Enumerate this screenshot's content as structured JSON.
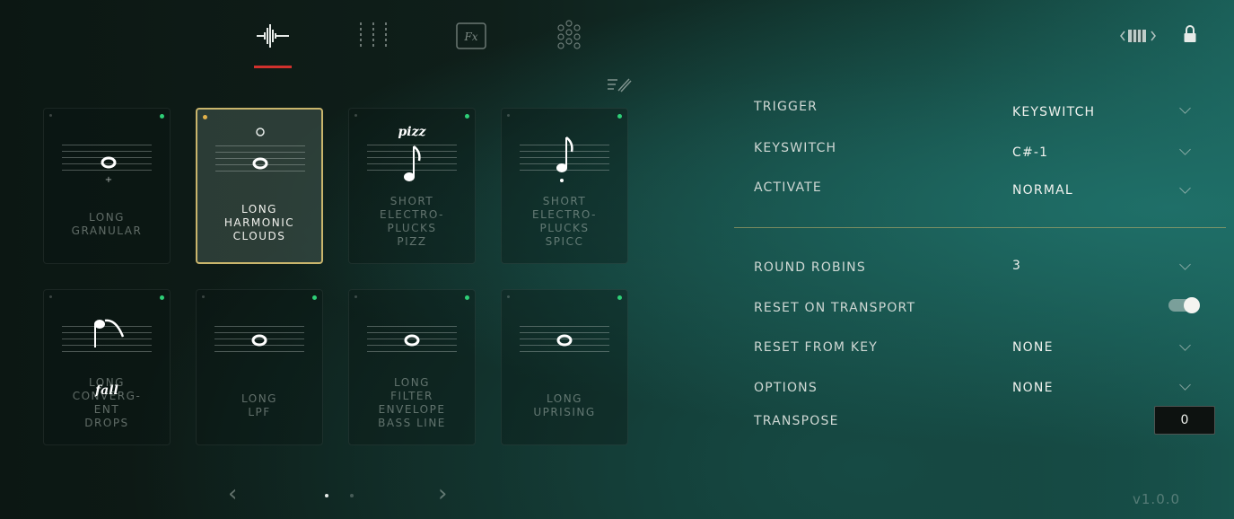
{
  "header": {
    "tabs": [
      {
        "icon": "waveform-icon"
      },
      {
        "icon": "mixer-sliders-icon"
      },
      {
        "icon": "fx-icon",
        "label": "Fx"
      },
      {
        "icon": "dots-grid-icon"
      }
    ],
    "active_tab": 0,
    "keyboard_icon": "keyboard-range-icon",
    "lock_icon": "lock-icon",
    "edit_icon": "edit-pencil-icon"
  },
  "articulations": [
    {
      "label": "LONG\nGRANULAR",
      "active_dot": true,
      "selected": false
    },
    {
      "label": "LONG\nHARMONIC\nCLOUDS",
      "active_dot": false,
      "selected": true
    },
    {
      "label": "SHORT\nELECTRO-\nPLUCKS\nPIZZ",
      "active_dot": true,
      "selected": false,
      "marking": "pizz"
    },
    {
      "label": "SHORT\nELECTRO-\nPLUCKS\nSPICC",
      "active_dot": true,
      "selected": false
    },
    {
      "label": "LONG\nCONVERG-\nENT\nDROPS",
      "active_dot": true,
      "selected": false,
      "marking": "fall"
    },
    {
      "label": "LONG\nLPF",
      "active_dot": true,
      "selected": false
    },
    {
      "label": "LONG\nFILTER\nENVELOPE\nBASS LINE",
      "active_dot": true,
      "selected": false
    },
    {
      "label": "LONG\nUPRISING",
      "active_dot": true,
      "selected": false
    }
  ],
  "pager": {
    "prev": "‹",
    "next": "›",
    "pages": 2,
    "current": 1
  },
  "settings": {
    "trigger": {
      "label": "TRIGGER",
      "value": "KEYSWITCH"
    },
    "keyswitch": {
      "label": "KEYSWITCH",
      "value": "C#-1"
    },
    "activate": {
      "label": "ACTIVATE",
      "value": "NORMAL"
    },
    "round_robins": {
      "label": "ROUND ROBINS",
      "value": "3"
    },
    "reset_on_transport": {
      "label": "RESET ON TRANSPORT",
      "enabled": true
    },
    "reset_from_key": {
      "label": "RESET FROM KEY",
      "value": "NONE"
    },
    "options": {
      "label": "OPTIONS",
      "value": "NONE"
    },
    "transpose": {
      "label": "TRANSPOSE",
      "value": "0"
    }
  },
  "version": "v1.0.0",
  "colors": {
    "accent_red": "#d0312d",
    "selected_border": "#c9b56c",
    "active_dot": "#2ecf77"
  }
}
